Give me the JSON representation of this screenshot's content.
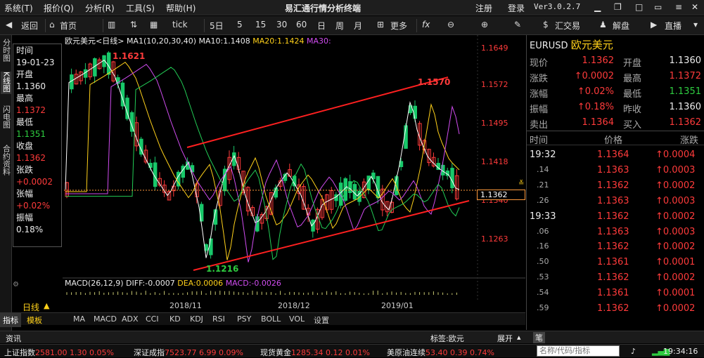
{
  "menu": {
    "items": [
      "系统(T)",
      "报价(Q)",
      "分析(R)",
      "工具(S)",
      "帮助(H)"
    ],
    "title": "易汇通行情分析终端",
    "register": "注册",
    "login": "登录",
    "version": "Ver3.0.2.7"
  },
  "toolbar": {
    "back": "返回",
    "home": "首页",
    "tick": "tick",
    "periods": [
      "5日",
      "5",
      "15",
      "30",
      "60",
      "日",
      "周",
      "月"
    ],
    "more": "更多",
    "trade": "汇交易",
    "unlock": "解盘",
    "live": "直播"
  },
  "left_tabs": [
    "分时图",
    "K线图",
    "闪电图",
    "合约资料"
  ],
  "infobox": {
    "time_label": "时间",
    "date": "19-01-23",
    "open_label": "开盘",
    "open": "1.1360",
    "high_label": "最高",
    "high": "1.1372",
    "low_label": "最低",
    "low": "1.1351",
    "close_label": "收盘",
    "close": "1.1362",
    "chg_label": "张跌",
    "chg": "+0.0002",
    "pct_label": "张幅",
    "pct": "+0.02%",
    "amp_label": "振幅",
    "amp": "0.18%"
  },
  "chart": {
    "title": "欧元美元<日线>",
    "ma_label": "MA1(10,20,30,40)",
    "ma10": "MA10:1.1408",
    "ma20": "MA20:1.1424",
    "ma30": "MA30:",
    "y_ticks": [
      "1.1649",
      "1.1572",
      "1.1495",
      "1.1418",
      "1.1340",
      "1.1263"
    ],
    "current_price": "1.1362",
    "hi_label": "1.1621",
    "hi2_label": "1.1570",
    "lo_label": "1.1216",
    "macd_title": "MACD(26,12,9)",
    "diff": "DIFF:-0.0007",
    "dea": "DEA:0.0006",
    "macd": "MACD:-0.0026",
    "x_labels": [
      "2018/11",
      "2018/12",
      "2019/01"
    ],
    "period_label": "日线"
  },
  "chart_data": {
    "type": "candlestick",
    "title": "欧元美元<日线>",
    "ylim": [
      1.12,
      1.166
    ],
    "x_labels": [
      "2018/11",
      "2018/12",
      "2019/01"
    ],
    "annotations": {
      "high": 1.1621,
      "high2": 1.157,
      "low": 1.1216,
      "last": 1.1362
    }
  },
  "bottom_tabs": [
    "指标",
    "模板",
    "MA",
    "MACD",
    "ADX",
    "CCI",
    "KD",
    "KDJ",
    "RSI",
    "PSY",
    "BOLL",
    "VOL",
    "设置"
  ],
  "infobar": {
    "left": "资讯",
    "tag": "标签:欧元",
    "expand": "展开",
    "pen": "笔"
  },
  "tickers": [
    {
      "name": "上证指数",
      "value": "2581.00",
      "chg": "1.30",
      "pct": "0.05%"
    },
    {
      "name": "深证成指",
      "value": "7523.77",
      "chg": "6.99",
      "pct": "0.09%"
    },
    {
      "name": "现货黄金",
      "value": "1285.34",
      "chg": "0.12",
      "pct": "0.01%"
    },
    {
      "name": "美原油连续",
      "value": "53.40",
      "chg": "0.39",
      "pct": "0.74%"
    }
  ],
  "search_placeholder": "名称/代码/指标",
  "clock": "19:34:16",
  "quote": {
    "symbol": "EURUSD",
    "name": "欧元美元",
    "rows": [
      [
        "现价",
        "1.1362",
        "开盘",
        "1.1360"
      ],
      [
        "涨跌",
        "0.0002",
        "最高",
        "1.1372"
      ],
      [
        "涨幅",
        "0.02%",
        "最低",
        "1.1351"
      ],
      [
        "振幅",
        "0.18%",
        "昨收",
        "1.1360"
      ],
      [
        "卖出",
        "1.1364",
        "买入",
        "1.1362"
      ]
    ],
    "trade_headers": [
      "时间",
      "价格",
      "涨跌"
    ],
    "trades": [
      [
        "19:32",
        "1.1364",
        "0.0004"
      ],
      [
        ".14",
        "1.1363",
        "0.0003"
      ],
      [
        ".21",
        "1.1362",
        "0.0002"
      ],
      [
        ".26",
        "1.1363",
        "0.0003"
      ],
      [
        "19:33",
        "1.1362",
        "0.0002"
      ],
      [
        ".06",
        "1.1363",
        "0.0003"
      ],
      [
        ".16",
        "1.1362",
        "0.0002"
      ],
      [
        ".50",
        "1.1361",
        "0.0001"
      ],
      [
        ".53",
        "1.1362",
        "0.0002"
      ],
      [
        ".54",
        "1.1361",
        "0.0001"
      ],
      [
        ".59",
        "1.1362",
        "0.0002"
      ]
    ]
  }
}
